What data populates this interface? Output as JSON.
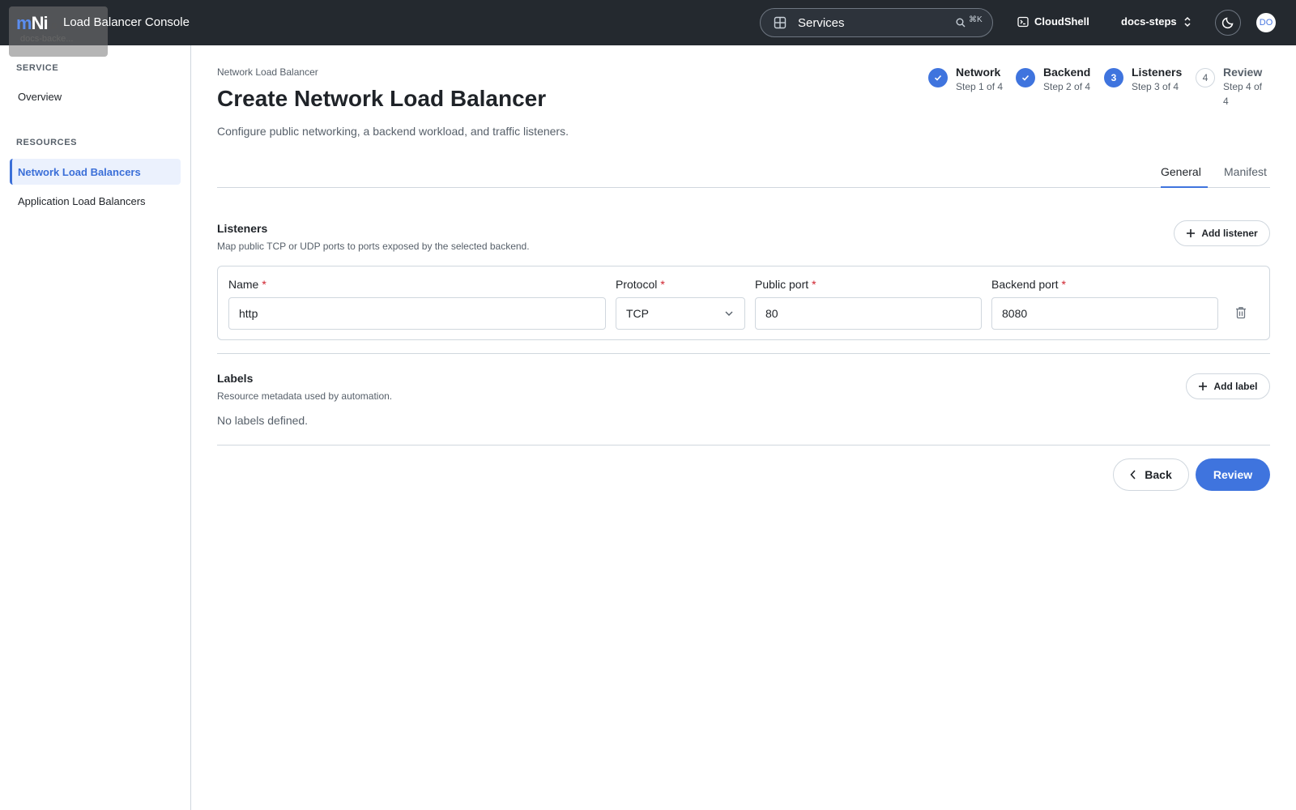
{
  "header": {
    "logo": {
      "part1": "m",
      "part2": "Ni"
    },
    "app_title": "Load Balancer Console",
    "ghost_line1": "Lo b",
    "ghost_line2": "docs-backe...",
    "search": {
      "label": "Services",
      "shortcut": "⌘K"
    },
    "cloudshell_label": "CloudShell",
    "project_label": "docs-steps",
    "avatar_initials": "DO"
  },
  "sidebar": {
    "service_heading": "SERVICE",
    "service_items": [
      {
        "label": "Overview"
      }
    ],
    "resources_heading": "RESOURCES",
    "resource_items": [
      {
        "label": "Network Load Balancers",
        "active": true
      },
      {
        "label": "Application Load Balancers",
        "active": false
      }
    ]
  },
  "page": {
    "breadcrumb": "Network Load Balancer",
    "title": "Create Network Load Balancer",
    "subtitle": "Configure public networking, a backend workload, and traffic listeners."
  },
  "steps": [
    {
      "number": "1",
      "title": "Network",
      "subtitle": "Step 1 of 4",
      "state": "done"
    },
    {
      "number": "2",
      "title": "Backend",
      "subtitle": "Step 2 of 4",
      "state": "done"
    },
    {
      "number": "3",
      "title": "Listeners",
      "subtitle": "Step 3 of 4",
      "state": "current"
    },
    {
      "number": "4",
      "title": "Review",
      "subtitle": "Step 4 of 4",
      "state": "todo"
    }
  ],
  "tabs": [
    {
      "label": "General",
      "active": true
    },
    {
      "label": "Manifest",
      "active": false
    }
  ],
  "listeners": {
    "title": "Listeners",
    "description": "Map public TCP or UDP ports to ports exposed by the selected backend.",
    "add_button": "Add listener",
    "fields": {
      "name": {
        "label": "Name",
        "value": "http"
      },
      "protocol": {
        "label": "Protocol",
        "value": "TCP"
      },
      "public_port": {
        "label": "Public port",
        "value": "80"
      },
      "backend_port": {
        "label": "Backend port",
        "value": "8080"
      }
    },
    "required_marker": "*"
  },
  "labels": {
    "title": "Labels",
    "description": "Resource metadata used by automation.",
    "add_button": "Add label",
    "empty_text": "No labels defined."
  },
  "footer": {
    "back_label": "Back",
    "review_label": "Review"
  },
  "colors": {
    "primary": "#3f74de",
    "topbar": "#24292f",
    "required": "#cf222e"
  }
}
